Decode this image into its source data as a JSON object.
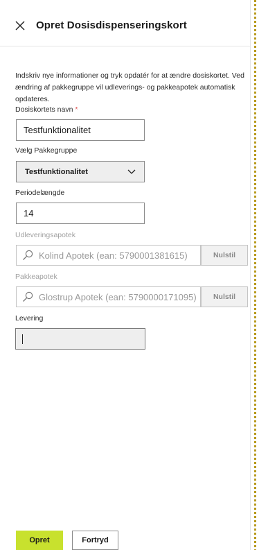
{
  "header": {
    "title": "Opret Dosisdispenseringskort",
    "close_icon": "close-icon"
  },
  "intro_text": "Indskriv nye informationer og tryk opdatér for at ændre dosiskortet. Ved ændring af pakkegruppe vil udleverings- og pakkeapotek automatisk opdateres.",
  "form": {
    "name_label": "Dosiskortets navn",
    "required_marker": "*",
    "name_value": "Testfunktionalitet",
    "group_label": "Vælg Pakkegruppe",
    "group_selected": "Testfunktionalitet",
    "period_label": "Periodelængde",
    "period_value": "14",
    "udlevering_label": "Udleveringsapotek",
    "udlevering_value": "Kolind Apotek (ean: 5790001381615)",
    "pakke_label": "Pakkeapotek",
    "pakke_value": "Glostrup Apotek (ean: 5790000171095)",
    "reset_label": "Nulstil",
    "levering_label": "Levering",
    "levering_value": ""
  },
  "footer": {
    "create_label": "Opret",
    "cancel_label": "Fortryd"
  },
  "colors": {
    "accent": "#c8e12e",
    "required": "#e05050",
    "muted_text": "#a0a0a0"
  }
}
